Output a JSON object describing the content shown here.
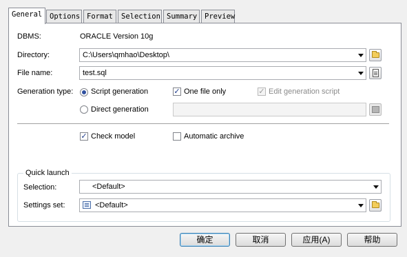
{
  "tabs": [
    {
      "label": "General",
      "active": true
    },
    {
      "label": "Options",
      "active": false
    },
    {
      "label": "Format",
      "active": false
    },
    {
      "label": "Selection",
      "active": false
    },
    {
      "label": "Summary",
      "active": false
    },
    {
      "label": "Preview",
      "active": false
    }
  ],
  "general": {
    "dbms_label": "DBMS:",
    "dbms_value": "ORACLE Version 10g",
    "directory_label": "Directory:",
    "directory_value": "C:\\Users\\qmhao\\Desktop\\",
    "filename_label": "File name:",
    "filename_value": "test.sql",
    "generation_type_label": "Generation type:",
    "script_generation": "Script generation",
    "script_generation_selected": true,
    "direct_generation": "Direct generation",
    "one_file_only": "One file only",
    "one_file_only_checked": true,
    "edit_generation_script": "Edit generation script",
    "edit_generation_script_checked": true,
    "edit_generation_script_enabled": false,
    "check_model": "Check model",
    "check_model_checked": true,
    "automatic_archive": "Automatic archive",
    "automatic_archive_checked": false
  },
  "quick_launch": {
    "title": "Quick launch",
    "selection_label": "Selection:",
    "selection_value": "<Default>",
    "settings_label": "Settings set:",
    "settings_value": "<Default>"
  },
  "footer": {
    "ok": "确定",
    "cancel": "取消",
    "apply": "应用(A)",
    "help": "帮助"
  },
  "icons": {
    "browse_folder": "folder-icon",
    "edit_file": "document-icon",
    "settings_list": "list-icon"
  }
}
